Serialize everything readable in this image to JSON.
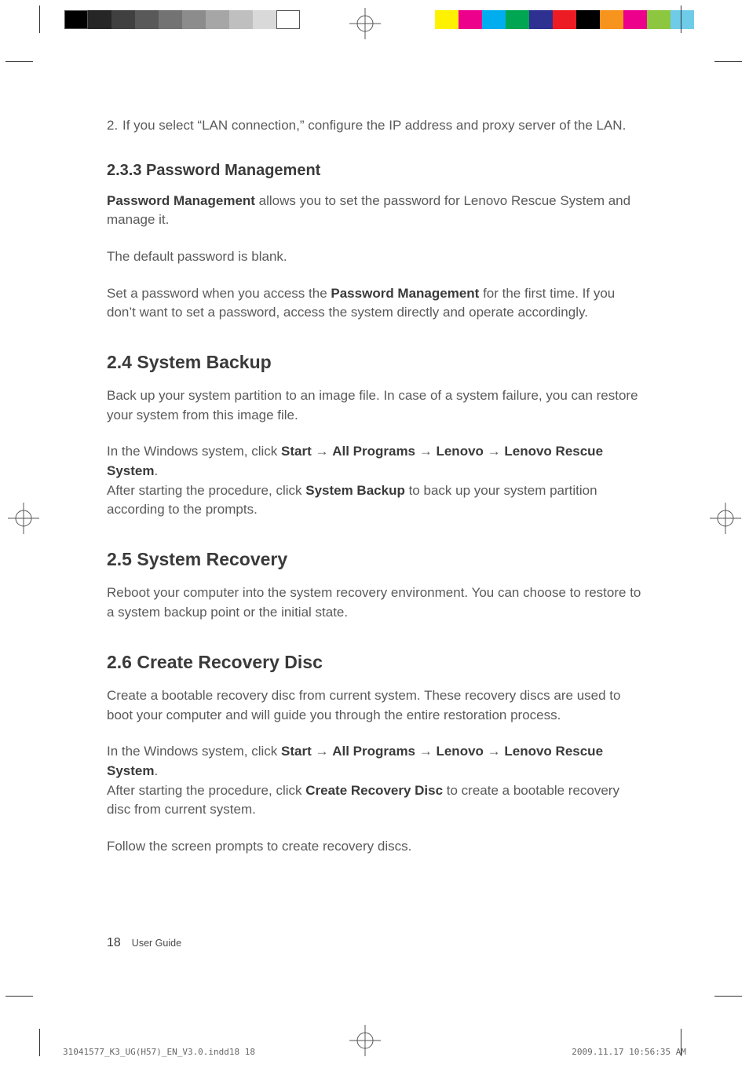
{
  "step": {
    "number": "2.",
    "text": "If you select “LAN connection,” configure the IP address and proxy server of the LAN."
  },
  "section_233": {
    "heading": "2.3.3 Password Management",
    "p1_bold": "Password Management",
    "p1_rest": " allows you to set the password for Lenovo Rescue System and manage it.",
    "p2": "The default password is blank.",
    "p3_a": "Set a password when you access the ",
    "p3_bold": "Password Management",
    "p3_b": " for the first time. If you don’t want to set a password, access the system directly and operate accordingly."
  },
  "section_24": {
    "heading": "2.4 System Backup",
    "p1": "Back up your system partition to an image file. In case of a system failure, you can restore your system from this image file.",
    "p2_a": "In the Windows system, click ",
    "p2_b1": "Start",
    "p2_arr1": " → ",
    "p2_b2": "All Programs",
    "p2_arr2": " → ",
    "p2_b3": "Lenovo",
    "p2_arr3": " → ",
    "p2_b4": "Lenovo Rescue System",
    "p2_period": ".",
    "p3_a": "After starting the procedure, click ",
    "p3_bold": "System Backup",
    "p3_b": " to back up your system partition according to the prompts."
  },
  "section_25": {
    "heading": "2.5 System Recovery",
    "p1": "Reboot your computer into the system recovery environment. You can choose to restore to a system backup point or the initial state."
  },
  "section_26": {
    "heading": "2.6 Create Recovery Disc",
    "p1": "Create a bootable recovery disc from current system. These recovery discs are used to boot your computer and will guide you through the entire restoration process.",
    "p2_a": "In the Windows system, click ",
    "p2_b1": "Start",
    "p2_arr1": " → ",
    "p2_b2": "All Programs",
    "p2_arr2": " → ",
    "p2_b3": "Lenovo",
    "p2_arr3": " → ",
    "p2_b4": "Lenovo Rescue System",
    "p2_period": ".",
    "p3_a": "After starting the procedure, click ",
    "p3_bold": "Create Recovery Disc",
    "p3_b": " to create a bootable recovery disc from current system.",
    "p4": "Follow the screen prompts to create recovery discs."
  },
  "footer": {
    "page": "18",
    "label": "User Guide"
  },
  "slug": {
    "left": "31041577_K3_UG(H57)_EN_V3.0.indd18   18",
    "right": "2009.11.17   10:56:35 AM"
  },
  "colors": {
    "gray_bar": [
      "#000000",
      "#262626",
      "#404040",
      "#595959",
      "#737373",
      "#8c8c8c",
      "#a6a6a6",
      "#bfbfbf",
      "#d9d9d9",
      "#ffffff"
    ],
    "color_bar": [
      "#fff200",
      "#ec008c",
      "#00aeef",
      "#00a651",
      "#2e3192",
      "#ed1c24",
      "#000000",
      "#f7941e",
      "#ed008c",
      "#8dc63f",
      "#00aeef"
    ]
  }
}
